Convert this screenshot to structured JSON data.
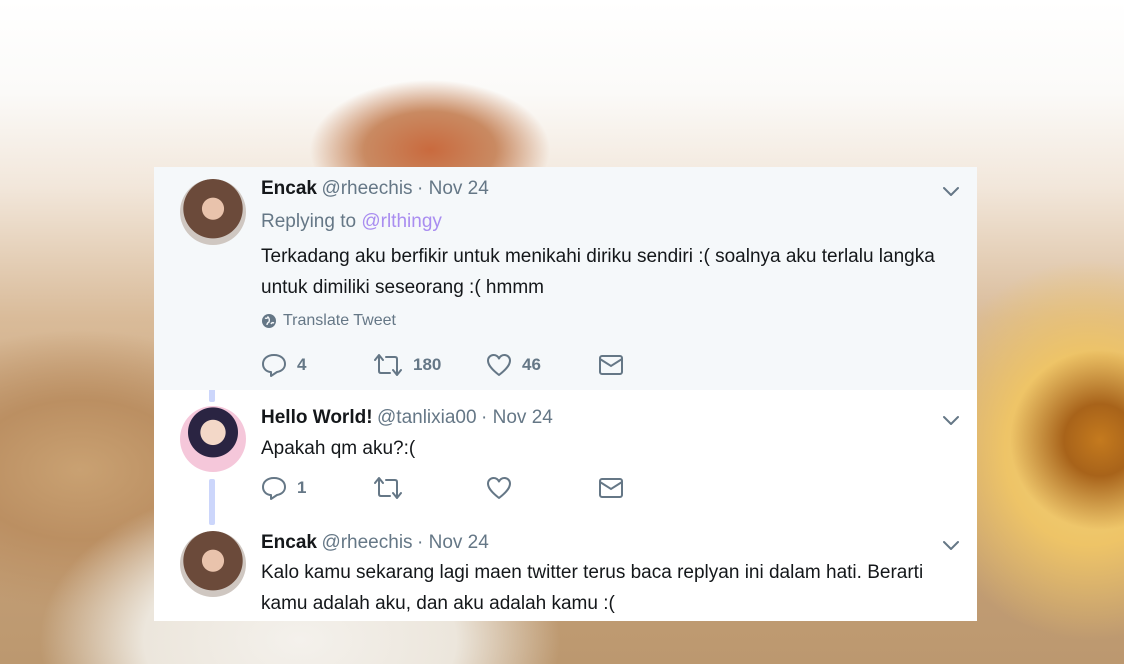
{
  "tweets": [
    {
      "name": "Encak",
      "handle": "@rheechis",
      "date": "· Nov 24",
      "replying_prefix": "Replying to",
      "replying_to": "@rlthingy",
      "text": "Terkadang aku berfikir untuk menikahi diriku sendiri :( soalnya aku terlalu langka untuk dimiliki seseorang :( hmmm",
      "translate": "Translate Tweet",
      "reply_count": "4",
      "retweet_count": "180",
      "like_count": "46"
    },
    {
      "name": "Hello World!",
      "handle": "@tanlixia00",
      "date": "· Nov 24",
      "text": "Apakah qm aku?:(",
      "reply_count": "1",
      "retweet_count": "",
      "like_count": ""
    },
    {
      "name": "Encak",
      "handle": "@rheechis",
      "date": "· Nov 24",
      "text": "Kalo kamu sekarang lagi maen twitter terus baca replyan ini dalam hati. Berarti kamu adalah aku, dan aku adalah kamu :("
    }
  ],
  "icons": {
    "reply": "reply-icon",
    "retweet": "retweet-icon",
    "like": "heart-icon",
    "dm": "envelope-icon",
    "more": "chevron-down-icon",
    "translate": "globe-icon"
  },
  "colors": {
    "name": "#14171a",
    "meta": "#657786",
    "link": "#a98df0",
    "thread_line": "#ccd6fb",
    "highlight_bg": "#f5f8fa"
  }
}
